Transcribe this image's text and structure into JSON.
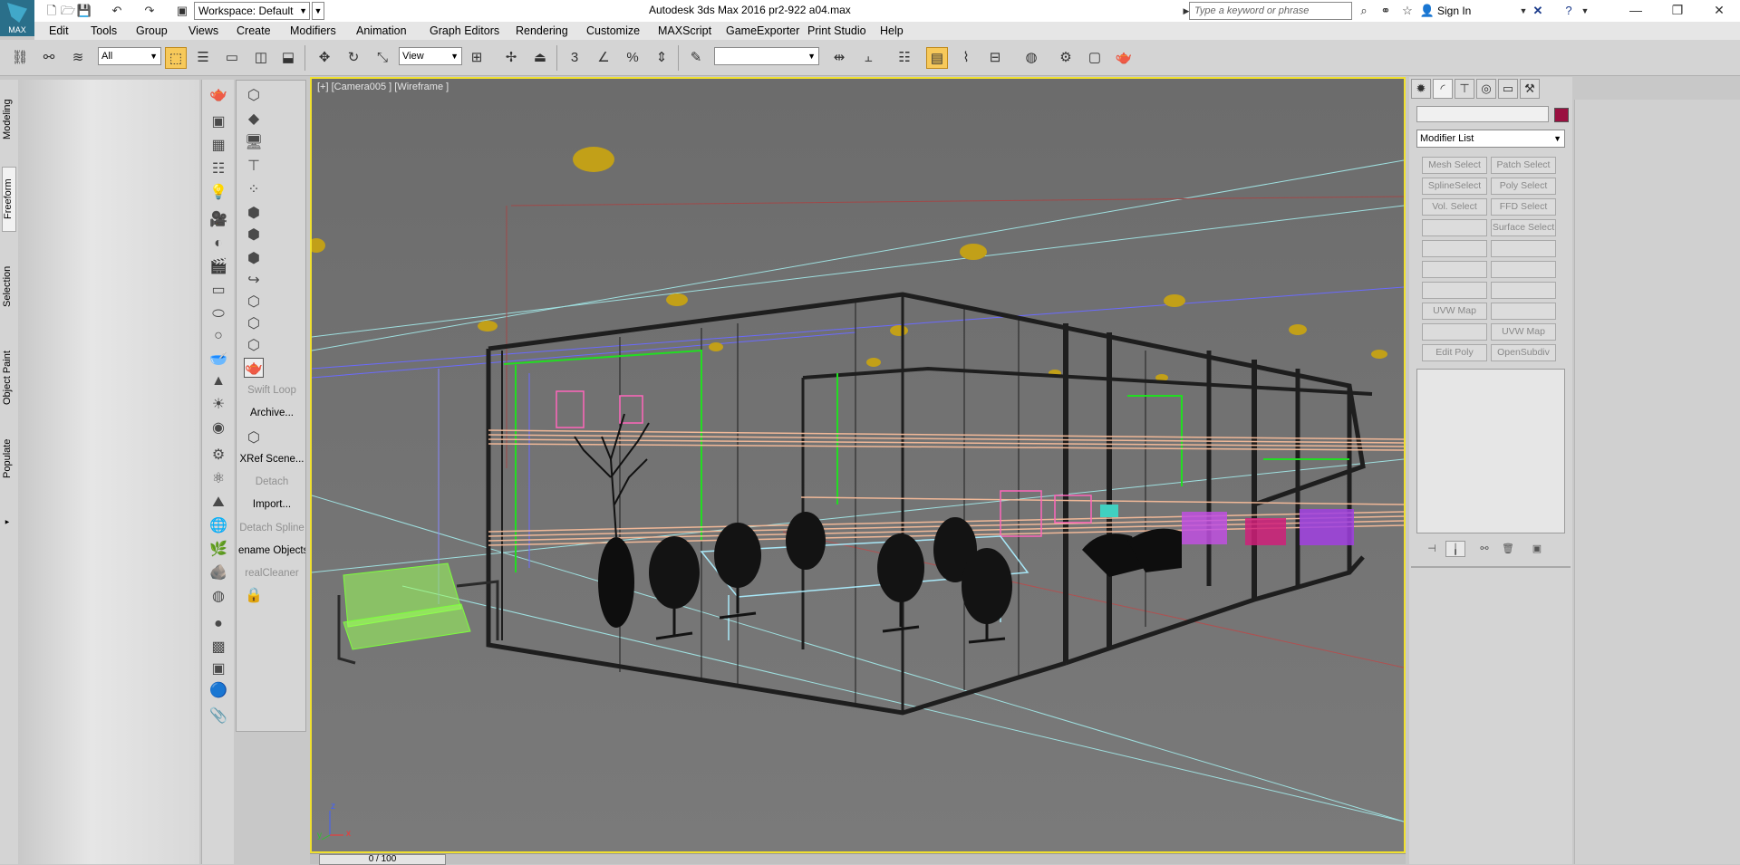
{
  "app": {
    "logo_text": "MAX",
    "title": "Autodesk 3ds Max 2016     pr2-922 a04.max",
    "workspace": "Workspace: Default",
    "search_placeholder": "Type a keyword or phrase",
    "sign_in": "Sign In"
  },
  "menu": [
    "Edit",
    "Tools",
    "Group",
    "Views",
    "Create",
    "Modifiers",
    "Animation",
    "Graph Editors",
    "Rendering",
    "Customize",
    "MAXScript",
    "GameExporter",
    "Print Studio",
    "Help"
  ],
  "toolbar": {
    "selection_filter": "All",
    "reference_coord": "View",
    "snap_label": "3",
    "named_selection": ""
  },
  "ribbon_tabs": [
    "Modeling",
    "Freeform",
    "Selection",
    "Object Paint",
    "Populate"
  ],
  "tools_col2": {
    "swift_loop": "Swift Loop",
    "archive": "Archive...",
    "xref_scene": "XRef Scene...",
    "detach": "Detach",
    "import": "Import...",
    "detach_spline": "Detach Spline",
    "rename_objects": "ename Objects",
    "real_cleaner": "realCleaner"
  },
  "viewport": {
    "label": "[+] [Camera005 ] [Wireframe ]",
    "axis_x": "x",
    "axis_y": "y",
    "axis_z": "z"
  },
  "timeslider": {
    "frame": "0 / 100"
  },
  "command_panel": {
    "modifier_list": "Modifier List",
    "buttons": [
      [
        "Mesh Select",
        "Patch Select"
      ],
      [
        "SplineSelect",
        "Poly Select"
      ],
      [
        "Vol. Select",
        "FFD Select"
      ],
      [
        "",
        "Surface Select"
      ],
      [
        "",
        ""
      ],
      [
        "",
        ""
      ],
      [
        "",
        ""
      ],
      [
        "UVW Map",
        ""
      ],
      [
        "",
        "UVW Map"
      ],
      [
        "Edit Poly",
        "OpenSubdiv"
      ]
    ],
    "object_color": "#9a1040"
  }
}
